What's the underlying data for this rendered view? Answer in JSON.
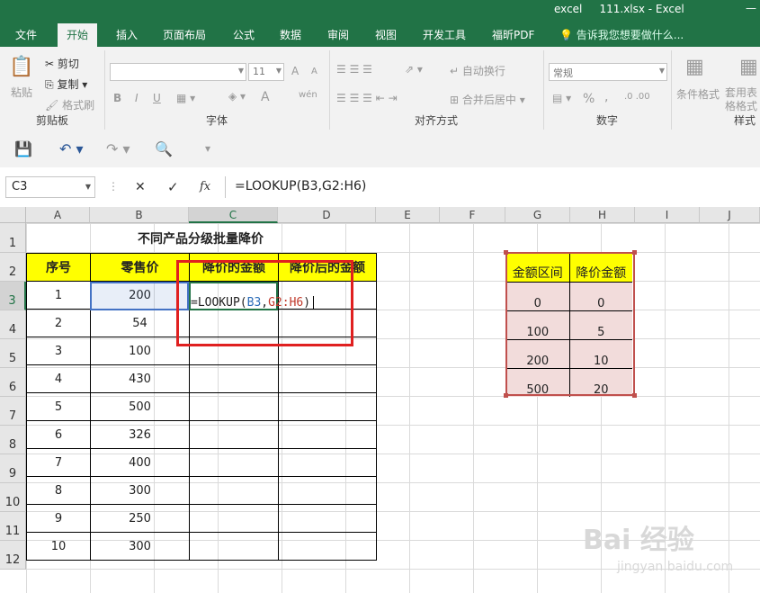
{
  "window": {
    "app": "excel",
    "file": "111.xlsx - Excel",
    "controls": "—"
  },
  "tabs": [
    "文件",
    "开始",
    "插入",
    "页面布局",
    "公式",
    "数据",
    "审阅",
    "视图",
    "开发工具",
    "福昕PDF"
  ],
  "active_tab": "开始",
  "tell_me": "告诉我您想要做什么...",
  "ribbon": {
    "clipboard": {
      "paste": "粘贴",
      "cut": "剪切",
      "copy": "复制",
      "format_painter": "格式刷",
      "label": "剪贴板"
    },
    "font": {
      "font_name": "",
      "font_size": "11",
      "bold": "B",
      "italic": "I",
      "underline": "U",
      "grow": "A",
      "shrink": "A",
      "font_color": "A",
      "phonetic": "wén",
      "label": "字体"
    },
    "alignment": {
      "wrap": "自动换行",
      "merge": "合并后居中",
      "label": "对齐方式"
    },
    "number": {
      "format": "常规",
      "percent": "%",
      "comma": ",",
      "label": "数字"
    },
    "styles": {
      "conditional": "条件格式",
      "table": "套用表格格式",
      "label": "样式"
    }
  },
  "formula_bar": {
    "name_box": "C3",
    "cancel": "✕",
    "enter": "✓",
    "fx": "fx",
    "formula": "=LOOKUP(B3,G2:H6)"
  },
  "columns": [
    "A",
    "B",
    "C",
    "D",
    "E",
    "F",
    "G",
    "H",
    "I",
    "J"
  ],
  "rows": [
    "1",
    "2",
    "3",
    "4",
    "5",
    "6",
    "7",
    "8",
    "9",
    "10",
    "11",
    "12"
  ],
  "sheet": {
    "title": "不同产品分级批量降价",
    "headers": [
      "序号",
      "零售价",
      "降价的金额",
      "降价后的金额"
    ],
    "data": [
      [
        "1",
        "200"
      ],
      [
        "2",
        "54"
      ],
      [
        "3",
        "100"
      ],
      [
        "4",
        "430"
      ],
      [
        "5",
        "500"
      ],
      [
        "6",
        "326"
      ],
      [
        "7",
        "400"
      ],
      [
        "8",
        "300"
      ],
      [
        "9",
        "250"
      ],
      [
        "10",
        "300"
      ]
    ],
    "editing": {
      "prefix": "=LOOKUP(",
      "ref1": "B3",
      "sep": ",",
      "ref2": "G2:H6",
      "suffix": ")"
    },
    "lookup_table": {
      "headers": [
        "金额区间",
        "降价金额"
      ],
      "rows": [
        [
          "0",
          "0"
        ],
        [
          "100",
          "5"
        ],
        [
          "200",
          "10"
        ],
        [
          "500",
          "20"
        ]
      ]
    }
  },
  "watermark": {
    "main": "Bai  经验",
    "sub": "jingyan.baidu.com"
  }
}
